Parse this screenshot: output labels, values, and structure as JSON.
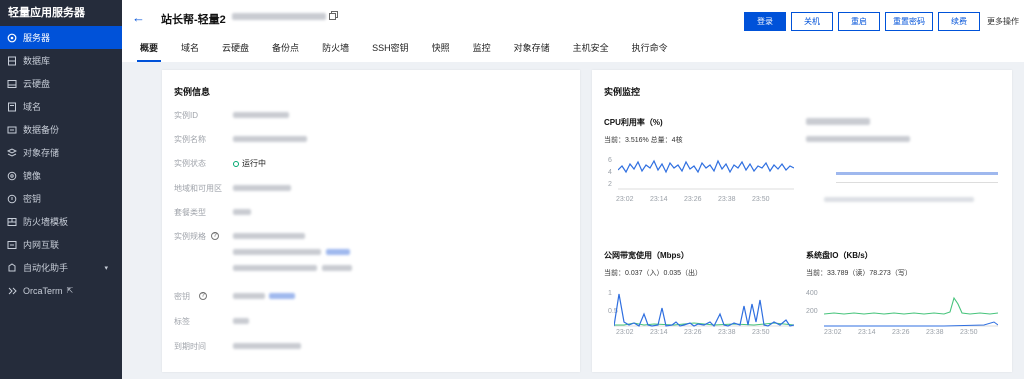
{
  "sidebar": {
    "title": "轻量应用服务器",
    "items": [
      {
        "label": "服务器",
        "icon": "server-icon",
        "active": true
      },
      {
        "label": "数据库",
        "icon": "database-icon"
      },
      {
        "label": "云硬盘",
        "icon": "disk-icon"
      },
      {
        "label": "域名",
        "icon": "domain-icon"
      },
      {
        "label": "数据备份",
        "icon": "backup-icon"
      },
      {
        "label": "对象存储",
        "icon": "storage-icon"
      },
      {
        "label": "镜像",
        "icon": "image-icon"
      },
      {
        "label": "密钥",
        "icon": "key-icon"
      },
      {
        "label": "防火墙模板",
        "icon": "firewall-icon"
      },
      {
        "label": "内网互联",
        "icon": "network-icon"
      },
      {
        "label": "自动化助手",
        "icon": "automation-icon",
        "chevron": "▾"
      },
      {
        "label": "OrcaTerm",
        "icon": "terminal-icon",
        "external": "⇱"
      }
    ]
  },
  "header": {
    "back": "←",
    "title": "站长帮-轻量2"
  },
  "actions": {
    "login": "登录",
    "shutdown": "关机",
    "restart": "重启",
    "reset_password": "重置密码",
    "renew": "续费",
    "more": "更多操作"
  },
  "tabs": [
    "概要",
    "域名",
    "云硬盘",
    "备份点",
    "防火墙",
    "SSH密钥",
    "快照",
    "监控",
    "对象存储",
    "主机安全",
    "执行命令"
  ],
  "instance": {
    "title": "实例信息",
    "fields": [
      {
        "label": "实例ID"
      },
      {
        "label": "实例名称"
      },
      {
        "label": "实例状态",
        "value": "运行中"
      },
      {
        "label": "地域和可用区"
      },
      {
        "label": "套餐类型"
      },
      {
        "label": "实例规格"
      },
      {
        "label": "密钥"
      },
      {
        "label": "标签"
      },
      {
        "label": "到期时间"
      }
    ]
  },
  "monitor": {
    "title": "实例监控",
    "cpu": {
      "title": "CPU利用率（%)",
      "current": "当前：3.516% 总量：4核",
      "yticks": [
        "6",
        "4",
        "2"
      ],
      "xticks": [
        "23:02",
        "23:14",
        "23:26",
        "23:38",
        "23:50"
      ]
    },
    "bandwidth": {
      "title": "公网带宽使用（Mbps）",
      "current": "当前：0.037（入）0.035（出）",
      "yticks": [
        "1",
        "0.5"
      ],
      "xticks": [
        "23:02",
        "23:14",
        "23:26",
        "23:38",
        "23:50"
      ]
    },
    "disk": {
      "title": "系统盘IO（KB/s）",
      "current": "当前：33.789（读）78.273（写）",
      "yticks": [
        "400",
        "200"
      ],
      "xticks": [
        "23:02",
        "23:14",
        "23:26",
        "23:38",
        "23:50"
      ]
    }
  },
  "colors": {
    "accent": "#0052d9",
    "sidebar": "#252c3b",
    "running": "#00a870",
    "chart_blue": "#2f6fe0",
    "chart_green": "#46c37b"
  }
}
